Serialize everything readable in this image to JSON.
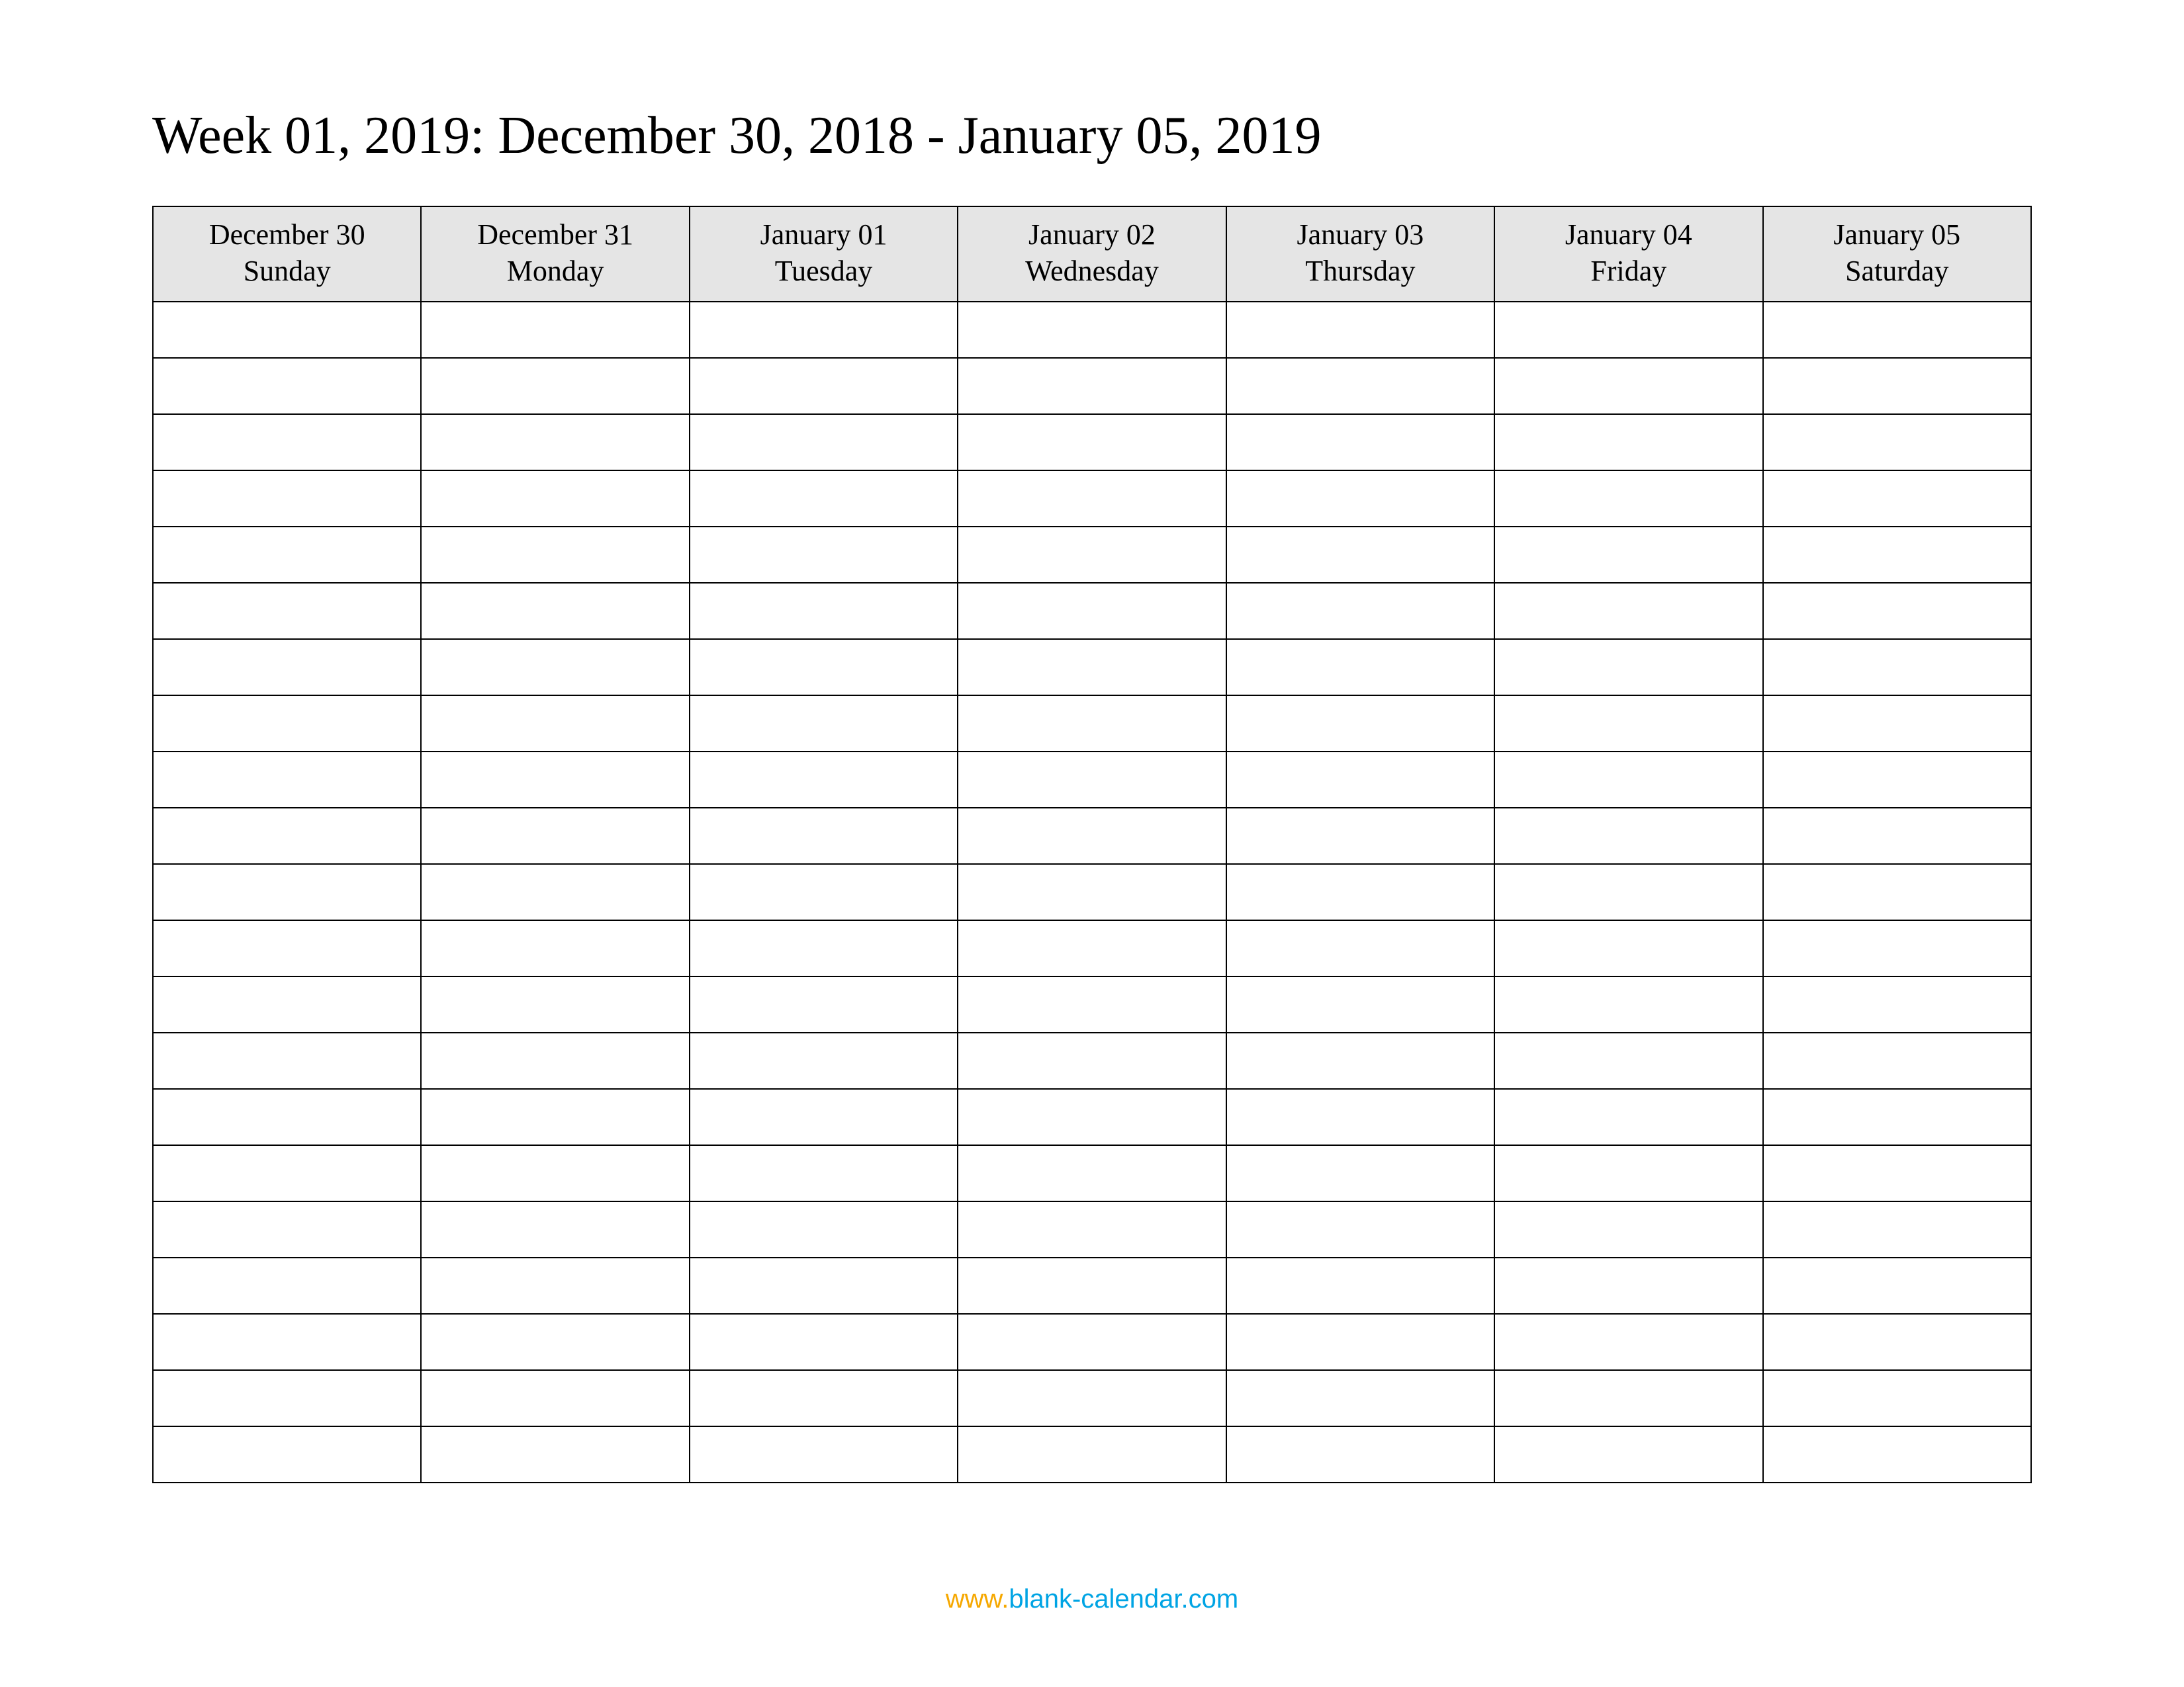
{
  "title": "Week 01, 2019: December 30, 2018 - January 05, 2019",
  "columns": [
    {
      "date": "December 30",
      "day": "Sunday"
    },
    {
      "date": "December 31",
      "day": "Monday"
    },
    {
      "date": "January 01",
      "day": "Tuesday"
    },
    {
      "date": "January 02",
      "day": "Wednesday"
    },
    {
      "date": "January 03",
      "day": "Thursday"
    },
    {
      "date": "January 04",
      "day": "Friday"
    },
    {
      "date": "January 05",
      "day": "Saturday"
    }
  ],
  "row_count": 21,
  "footer": {
    "www": "www",
    "dot1": ".",
    "blank": "blank",
    "dash": "-",
    "cal": "calendar",
    "dot2": ".",
    "com": "com"
  }
}
